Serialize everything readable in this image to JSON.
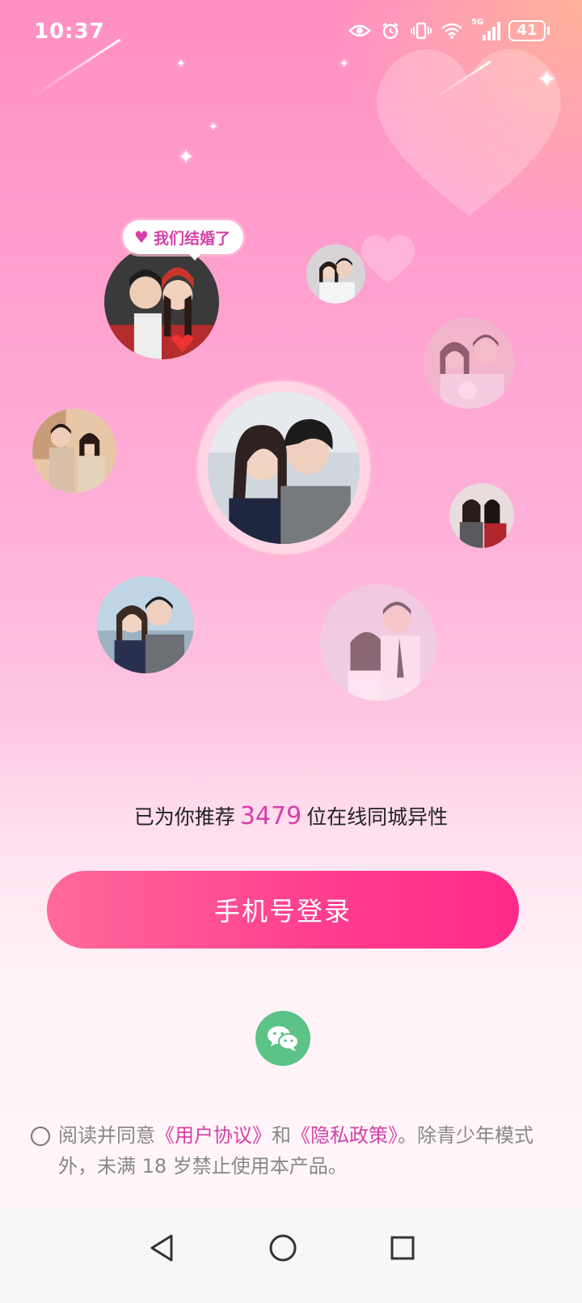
{
  "status_bar": {
    "time": "10:37",
    "network": "5G",
    "battery": "41",
    "icons": [
      "eye-icon",
      "alarm-icon",
      "vibrate-icon",
      "wifi-icon",
      "signal-icon",
      "battery-icon"
    ]
  },
  "bubble": {
    "text": "我们结婚了",
    "icon": "heart-icon"
  },
  "recommend": {
    "prefix": "已为你推荐",
    "count": "3479",
    "suffix": "位在线同城异性"
  },
  "login_button": {
    "label": "手机号登录"
  },
  "wechat": {
    "icon": "wechat-icon"
  },
  "agreement": {
    "prefix": "阅读并同意",
    "user_agreement": "《用户协议》",
    "and": "和",
    "privacy_policy": "《隐私政策》",
    "suffix": "。除青少年模式外，未满 18 岁禁止使用本产品。"
  },
  "nav": {
    "icons": [
      "back-icon",
      "home-icon",
      "recents-icon"
    ]
  },
  "colors": {
    "accent": "#d63fa6",
    "button": "#ff3d8f",
    "wechat": "#5bc385"
  }
}
